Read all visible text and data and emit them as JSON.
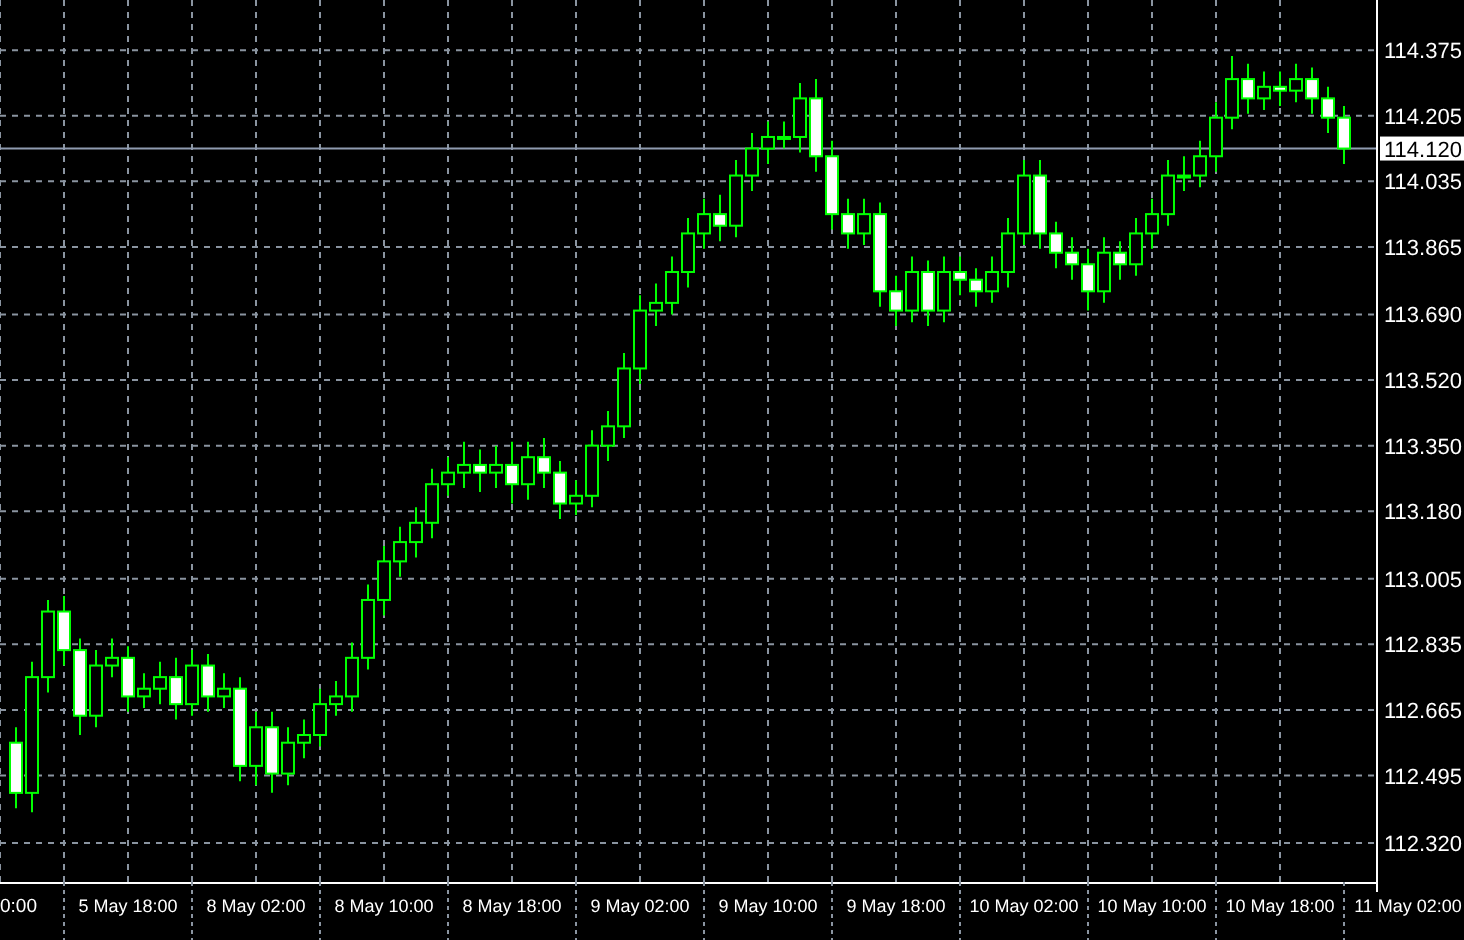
{
  "chart": {
    "x_axis_cut_label": "0:00",
    "chart_data": {
      "type": "candlestick",
      "grid": true,
      "categories": [
        null,
        null,
        null,
        null,
        null,
        null,
        null,
        "5 May 18:00",
        null,
        null,
        null,
        null,
        null,
        null,
        null,
        "8 May 02:00",
        null,
        null,
        null,
        null,
        null,
        null,
        null,
        "8 May 10:00",
        null,
        null,
        null,
        null,
        null,
        null,
        null,
        "8 May 18:00",
        null,
        null,
        null,
        null,
        null,
        null,
        null,
        "9 May 02:00",
        null,
        null,
        null,
        null,
        null,
        null,
        null,
        "9 May 10:00",
        null,
        null,
        null,
        null,
        null,
        null,
        null,
        "9 May 18:00",
        null,
        null,
        null,
        null,
        null,
        null,
        null,
        "10 May 02:00",
        null,
        null,
        null,
        null,
        null,
        null,
        null,
        "10 May 10:00",
        null,
        null,
        null,
        null,
        null,
        null,
        null,
        "10 May 18:00",
        null,
        null,
        null,
        null,
        null,
        null,
        null,
        "11 May 02:00"
      ],
      "ylim": [
        112.219,
        114.505
      ],
      "ref_lines": [
        {
          "axis": "y",
          "value": 114.12,
          "label": "114.120"
        }
      ],
      "ohlc": [
        [
          112.58,
          112.62,
          112.41,
          112.45
        ],
        [
          112.45,
          112.79,
          112.4,
          112.75
        ],
        [
          112.75,
          112.95,
          112.71,
          112.92
        ],
        [
          112.92,
          112.96,
          112.78,
          112.82
        ],
        [
          112.82,
          112.85,
          112.6,
          112.65
        ],
        [
          112.65,
          112.82,
          112.62,
          112.78
        ],
        [
          112.78,
          112.85,
          112.75,
          112.8
        ],
        [
          112.8,
          112.83,
          112.66,
          112.7
        ],
        [
          112.7,
          112.76,
          112.67,
          112.72
        ],
        [
          112.72,
          112.79,
          112.68,
          112.75
        ],
        [
          112.75,
          112.8,
          112.64,
          112.68
        ],
        [
          112.68,
          112.82,
          112.65,
          112.78
        ],
        [
          112.78,
          112.81,
          112.66,
          112.7
        ],
        [
          112.7,
          112.76,
          112.67,
          112.72
        ],
        [
          112.72,
          112.75,
          112.48,
          112.52
        ],
        [
          112.52,
          112.66,
          112.47,
          112.62
        ],
        [
          112.62,
          112.66,
          112.45,
          112.5
        ],
        [
          112.5,
          112.62,
          112.47,
          112.58
        ],
        [
          112.58,
          112.64,
          112.54,
          112.6
        ],
        [
          112.6,
          112.72,
          112.57,
          112.68
        ],
        [
          112.68,
          112.74,
          112.65,
          112.7
        ],
        [
          112.7,
          112.84,
          112.66,
          112.8
        ],
        [
          112.8,
          112.99,
          112.77,
          112.95
        ],
        [
          112.95,
          113.09,
          112.91,
          113.05
        ],
        [
          113.05,
          113.14,
          113.01,
          113.1
        ],
        [
          113.1,
          113.19,
          113.06,
          113.15
        ],
        [
          113.15,
          113.29,
          113.11,
          113.25
        ],
        [
          113.25,
          113.32,
          113.22,
          113.28
        ],
        [
          113.28,
          113.36,
          113.24,
          113.3
        ],
        [
          113.3,
          113.34,
          113.23,
          113.28
        ],
        [
          113.28,
          113.35,
          113.24,
          113.3
        ],
        [
          113.3,
          113.36,
          113.2,
          113.25
        ],
        [
          113.25,
          113.36,
          113.21,
          113.32
        ],
        [
          113.32,
          113.37,
          113.24,
          113.28
        ],
        [
          113.28,
          113.31,
          113.16,
          113.2
        ],
        [
          113.2,
          113.26,
          113.17,
          113.22
        ],
        [
          113.22,
          113.39,
          113.19,
          113.35
        ],
        [
          113.35,
          113.44,
          113.31,
          113.4
        ],
        [
          113.4,
          113.59,
          113.37,
          113.55
        ],
        [
          113.55,
          113.74,
          113.51,
          113.7
        ],
        [
          113.7,
          113.77,
          113.66,
          113.72
        ],
        [
          113.72,
          113.84,
          113.69,
          113.8
        ],
        [
          113.8,
          113.94,
          113.76,
          113.9
        ],
        [
          113.9,
          113.99,
          113.86,
          113.95
        ],
        [
          113.95,
          114.0,
          113.88,
          113.92
        ],
        [
          113.92,
          114.09,
          113.89,
          114.05
        ],
        [
          114.05,
          114.16,
          114.01,
          114.12
        ],
        [
          114.12,
          114.19,
          114.08,
          114.15
        ],
        [
          114.15,
          114.19,
          114.12,
          114.15
        ],
        [
          114.15,
          114.29,
          114.11,
          114.25
        ],
        [
          114.25,
          114.3,
          114.06,
          114.1
        ],
        [
          114.1,
          114.14,
          113.91,
          113.95
        ],
        [
          113.95,
          113.99,
          113.86,
          113.9
        ],
        [
          113.9,
          113.99,
          113.87,
          113.95
        ],
        [
          113.95,
          113.98,
          113.71,
          113.75
        ],
        [
          113.75,
          113.79,
          113.66,
          113.7
        ],
        [
          113.7,
          113.84,
          113.67,
          113.8
        ],
        [
          113.8,
          113.83,
          113.66,
          113.7
        ],
        [
          113.7,
          113.84,
          113.67,
          113.8
        ],
        [
          113.8,
          113.84,
          113.74,
          113.78
        ],
        [
          113.78,
          113.81,
          113.71,
          113.75
        ],
        [
          113.75,
          113.84,
          113.72,
          113.8
        ],
        [
          113.8,
          113.94,
          113.76,
          113.9
        ],
        [
          113.9,
          114.09,
          113.87,
          114.05
        ],
        [
          114.05,
          114.09,
          113.86,
          113.9
        ],
        [
          113.9,
          113.93,
          113.81,
          113.85
        ],
        [
          113.85,
          113.89,
          113.78,
          113.82
        ],
        [
          113.82,
          113.86,
          113.7,
          113.75
        ],
        [
          113.75,
          113.89,
          113.72,
          113.85
        ],
        [
          113.85,
          113.88,
          113.78,
          113.82
        ],
        [
          113.82,
          113.94,
          113.79,
          113.9
        ],
        [
          113.9,
          113.99,
          113.86,
          113.95
        ],
        [
          113.95,
          114.09,
          113.92,
          114.05
        ],
        [
          114.05,
          114.1,
          114.01,
          114.05
        ],
        [
          114.05,
          114.14,
          114.02,
          114.1
        ],
        [
          114.1,
          114.24,
          114.06,
          114.2
        ],
        [
          114.2,
          114.36,
          114.17,
          114.3
        ],
        [
          114.3,
          114.34,
          114.21,
          114.25
        ],
        [
          114.25,
          114.32,
          114.22,
          114.28
        ],
        [
          114.28,
          114.32,
          114.23,
          114.27
        ],
        [
          114.27,
          114.34,
          114.24,
          114.3
        ],
        [
          114.3,
          114.33,
          114.21,
          114.25
        ],
        [
          114.25,
          114.28,
          114.16,
          114.2
        ],
        [
          114.2,
          114.23,
          114.08,
          114.12
        ],
        null,
        null,
        null,
        null
      ],
      "yticks": [
        {
          "value": 114.375,
          "label": "114.375"
        },
        {
          "value": 114.205,
          "label": "114.205"
        },
        {
          "value": 114.035,
          "label": "114.035"
        },
        {
          "value": 113.865,
          "label": "113.865"
        },
        {
          "value": 113.69,
          "label": "113.690"
        },
        {
          "value": 113.52,
          "label": "113.520"
        },
        {
          "value": 113.35,
          "label": "113.350"
        },
        {
          "value": 113.18,
          "label": "113.180"
        },
        {
          "value": 113.005,
          "label": "113.005"
        },
        {
          "value": 112.835,
          "label": "112.835"
        },
        {
          "value": 112.665,
          "label": "112.665"
        },
        {
          "value": 112.495,
          "label": "112.495"
        },
        {
          "value": 112.32,
          "label": "112.320"
        }
      ]
    }
  }
}
